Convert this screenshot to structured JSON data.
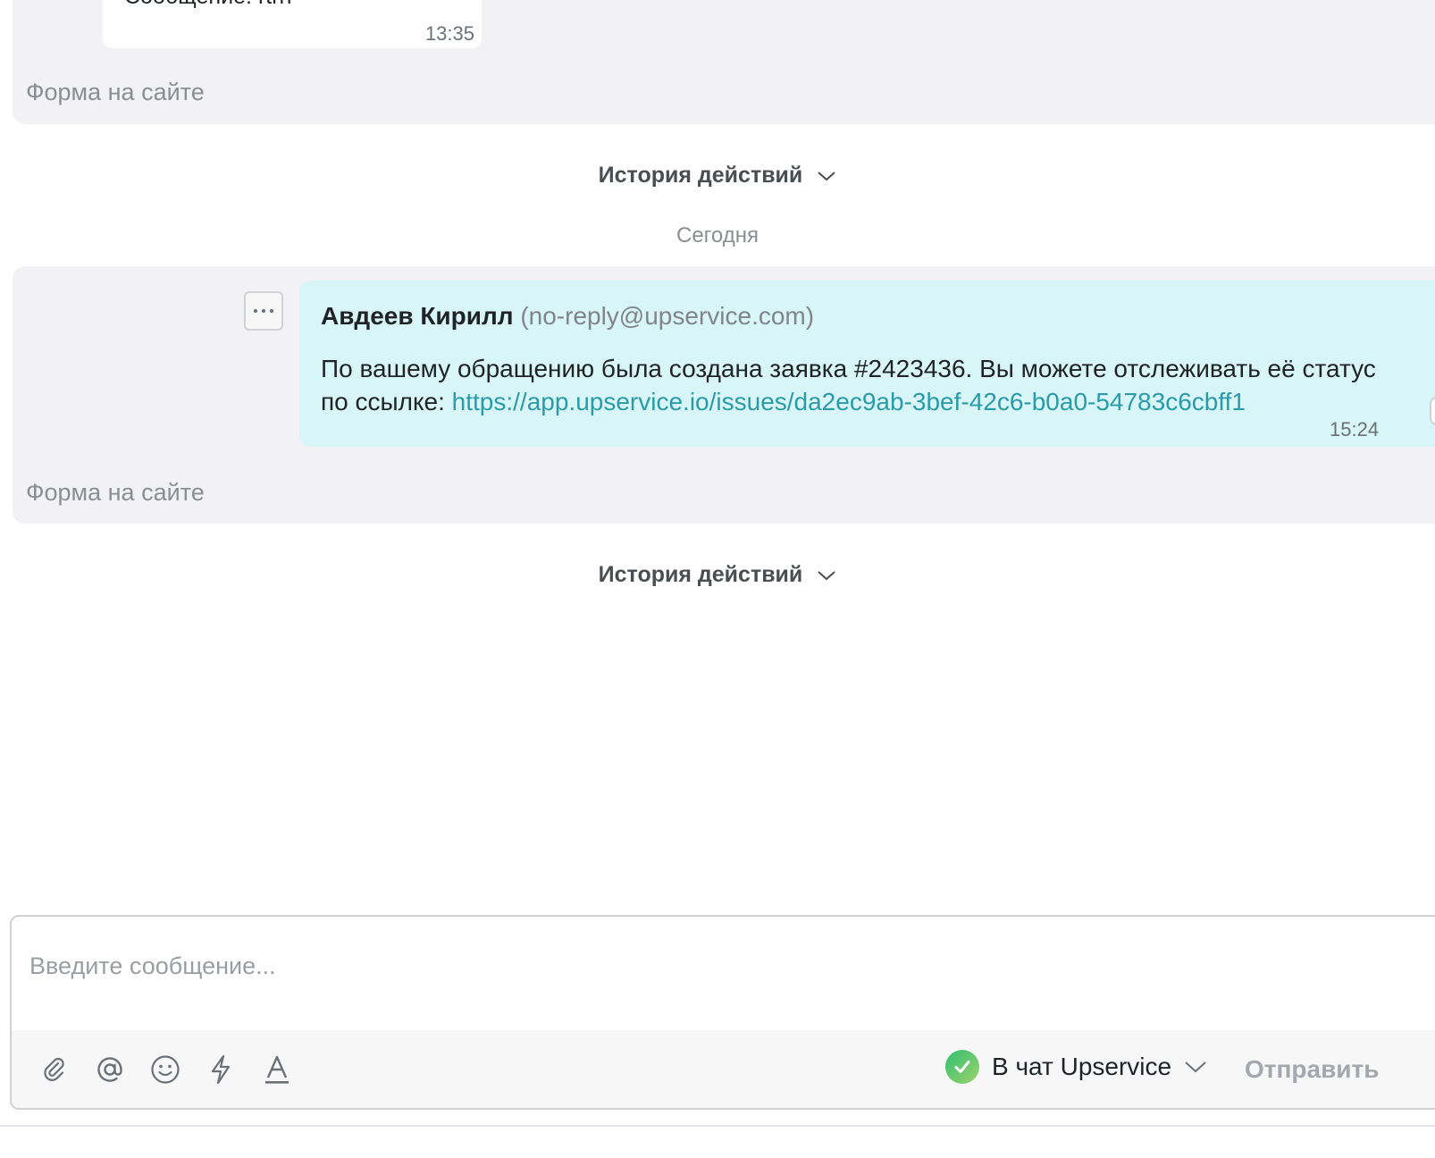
{
  "messages": {
    "first": {
      "text": "Сообщение: rtrh",
      "time": "13:35",
      "source": "Форма на сайте"
    },
    "second": {
      "author_name": "Авдеев Кирилл",
      "author_email": "(no-reply@upservice.com)",
      "body_text": "По вашему обращению была создана заявка #2423436. Вы можете отслеживать её статус по ссылке: ",
      "link": "https://app.upservice.io/issues/da2ec9ab-3bef-42c6-b0a0-54783c6cbff1",
      "time": "15:24",
      "source": "Форма на сайте"
    }
  },
  "history_label": "История действий",
  "date_divider": "Сегодня",
  "composer": {
    "placeholder": "Введите сообщение...",
    "channel_label": "В чат Upservice",
    "send_label": "Отправить",
    "tools": [
      "paperclip-icon",
      "at-sign-icon",
      "smile-icon",
      "lightning-icon",
      "text-format-icon"
    ]
  },
  "colors": {
    "bubble_cyan": "#d8f5f7",
    "link": "#2a9ba8",
    "card_bg": "#f2f2f4",
    "channel_check": "#2fbf71"
  }
}
